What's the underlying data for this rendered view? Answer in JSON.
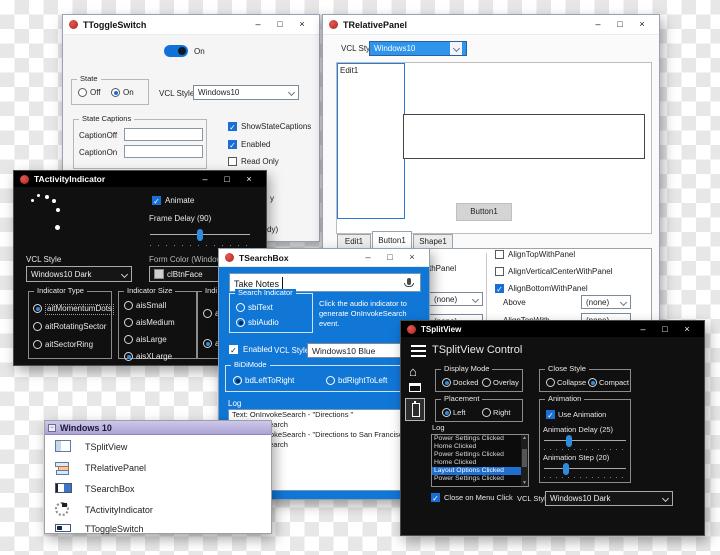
{
  "chrome": {
    "minimize": "–",
    "maximize": "□",
    "close": "×"
  },
  "toggle_switch_window": {
    "title": "TToggleSwitch",
    "toggle_label": "On",
    "state_group": {
      "caption": "State",
      "options": [
        {
          "label": "Off",
          "selected": false
        },
        {
          "label": "On",
          "selected": true
        }
      ]
    },
    "vcl_style_label": "VCL Style",
    "vcl_style_value": "Windows10",
    "state_captions_group": {
      "caption": "State Captions",
      "caption_off_label": "CaptionOff",
      "caption_on_label": "CaptionOn",
      "caption_off_value": "",
      "caption_on_value": ""
    },
    "checkboxes": [
      {
        "label": "ShowStateCaptions",
        "checked": true
      },
      {
        "label": "Enabled",
        "checked": true
      },
      {
        "label": "Read Only",
        "checked": false
      }
    ],
    "fragments": {
      "frag1": "y",
      "frag2": "dy)"
    }
  },
  "relative_panel_window": {
    "title": "TRelativePanel",
    "vcl_style_label": "VCL Style",
    "vcl_style_value": "Windows10",
    "edit1_text": "Edit1",
    "button1_label": "Button1",
    "tabs": [
      {
        "label": "Edit1",
        "selected": false
      },
      {
        "label": "Button1",
        "selected": true
      },
      {
        "label": "Shape1",
        "selected": false
      }
    ],
    "left_column": {
      "label_fragment": "thPanel",
      "dropdown1": "(none)",
      "dropdown2": "(none)"
    },
    "right_column": {
      "checkboxes": [
        {
          "label": "AlignTopWithPanel",
          "checked": false
        },
        {
          "label": "AlignVerticalCenterWithPanel",
          "checked": false
        },
        {
          "label": "AlignBottomWithPanel",
          "checked": true
        }
      ],
      "rows": [
        {
          "label": "Above",
          "value": "(none)"
        },
        {
          "label": "AlignTopWith",
          "value": "(none)"
        }
      ]
    }
  },
  "activity_indicator_window": {
    "title": "TActivityIndicator",
    "animate_label": "Animate",
    "frame_delay_label": "Frame Delay (90)",
    "vcl_style_label": "VCL Style",
    "vcl_style_value": "Windows10 Dark",
    "form_color_label": "Form Color (Windows",
    "form_color_value": "clBtnFace",
    "indicator_type_group": {
      "caption": "Indicator Type",
      "options": [
        {
          "label": "aitMomentumDots",
          "selected": true
        },
        {
          "label": "aitRotatingSector",
          "selected": false
        },
        {
          "label": "aitSectorRing",
          "selected": false
        }
      ]
    },
    "indicator_size_group": {
      "caption": "Indicator Size",
      "options": [
        {
          "label": "aisSmall",
          "selected": false
        },
        {
          "label": "aisMedium",
          "selected": false
        },
        {
          "label": "aisLarge",
          "selected": false
        },
        {
          "label": "aisXLarge",
          "selected": true
        }
      ]
    },
    "third_group": {
      "caption": "Indi",
      "options": [
        {
          "label": "a",
          "selected": false
        },
        {
          "label": "a",
          "selected": true
        }
      ]
    }
  },
  "search_box_window": {
    "title": "TSearchBox",
    "search_value": "Take Notes",
    "search_indicator_group": {
      "caption": "Search Indicator",
      "options": [
        {
          "label": "sbiText",
          "selected": false
        },
        {
          "label": "sbiAudio",
          "selected": true
        }
      ]
    },
    "hint_text": "Click the audio indicator to generate OnInvokeSearch event.",
    "enabled_label": "Enabled",
    "vcl_style_label": "VCL Style",
    "vcl_style_value": "Windows10 Blue",
    "bidi_group": {
      "caption": "BiDiMode",
      "options": [
        {
          "label": "bdLeftToRight",
          "selected": true
        },
        {
          "label": "bdRightToLeft",
          "selected": false
        }
      ]
    },
    "log_label": "Log",
    "log_lines": [
      "Text: OnInvokeSearch - \"Directions \"",
      "OnInvokeSearch",
      "Text: OnInvokeSearch - \"Directions to San Francisco\"",
      "OnInvokeSearch"
    ]
  },
  "split_view_window": {
    "title": "TSplitView",
    "heading": "TSplitView Control",
    "display_mode_group": {
      "caption": "Display Mode",
      "options": [
        {
          "label": "Docked",
          "selected": true
        },
        {
          "label": "Overlay",
          "selected": false
        }
      ]
    },
    "close_style_group": {
      "caption": "Close Style",
      "options": [
        {
          "label": "Collapse",
          "selected": false
        },
        {
          "label": "Compact",
          "selected": true
        }
      ]
    },
    "placement_group": {
      "caption": "Placement",
      "options": [
        {
          "label": "Left",
          "selected": true
        },
        {
          "label": "Right",
          "selected": false
        }
      ]
    },
    "animation_group": {
      "caption": "Animation",
      "use_animation_label": "Use Animation",
      "use_animation_checked": true,
      "delay_label": "Animation Delay (25)",
      "step_label": "Animation Step (20)"
    },
    "log_label": "Log",
    "log_items": [
      {
        "label": "Power Settings Clicked",
        "selected": false
      },
      {
        "label": "Home Clicked",
        "selected": false
      },
      {
        "label": "Power Settings Clicked",
        "selected": false
      },
      {
        "label": "Home Clicked",
        "selected": false
      },
      {
        "label": "Layout Options Clicked",
        "selected": true
      },
      {
        "label": "Power Settings Clicked",
        "selected": false
      }
    ],
    "close_on_menu_label": "Close on Menu Click",
    "vcl_style_label": "VCL Style",
    "vcl_style_value": "Windows10 Dark"
  },
  "component_list_window": {
    "header": "Windows 10",
    "items": [
      "TSplitView",
      "TRelativePanel",
      "TSearchBox",
      "TActivityIndicator",
      "TToggleSwitch"
    ]
  },
  "colors": {
    "accent_blue": "#1177d7",
    "selection_blue": "#1f6fd0",
    "dark_bg": "#101010",
    "header_lavender": "#b6aede"
  }
}
